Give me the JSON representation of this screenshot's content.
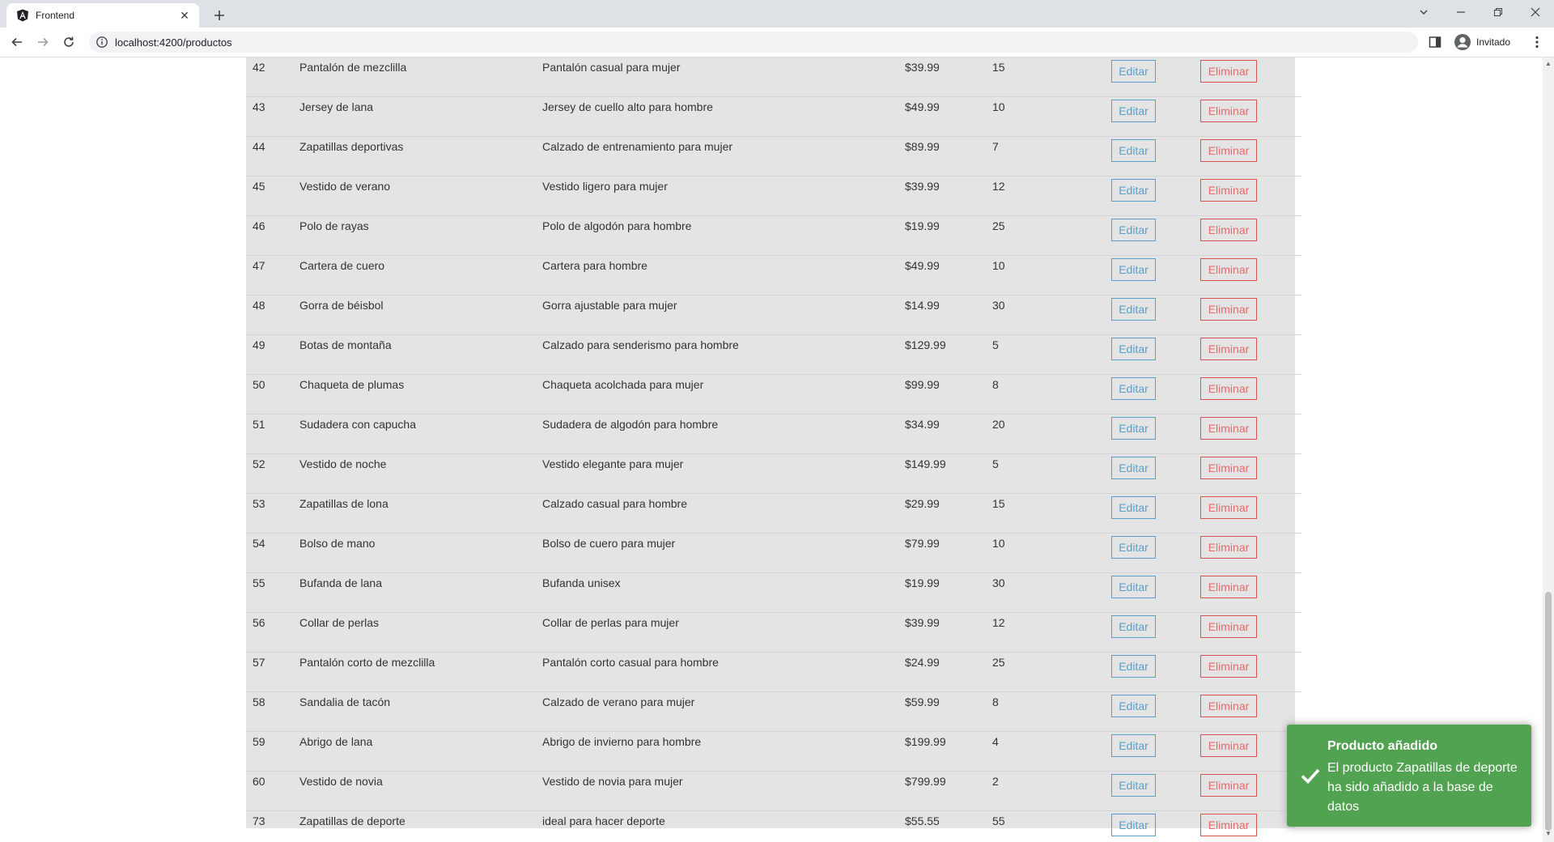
{
  "browser": {
    "tab_title": "Frontend",
    "url": "localhost:4200/productos",
    "profile_label": "Invitado"
  },
  "colors": {
    "edit_button": "#5a9fc8",
    "delete_button": "#d9534f",
    "toast_success": "#51a351",
    "table_background": "#e4e4e4"
  },
  "icons": {
    "tab_favicon": "angular-logo-icon",
    "toast": "checkmark-icon"
  },
  "products": [
    {
      "id": "42",
      "name": "Pantalón de mezclilla",
      "description": "Pantalón casual para mujer",
      "price": "$39.99",
      "stock": "15",
      "edit_label": "Editar",
      "delete_label": "Eliminar"
    },
    {
      "id": "43",
      "name": "Jersey de lana",
      "description": "Jersey de cuello alto para hombre",
      "price": "$49.99",
      "stock": "10",
      "edit_label": "Editar",
      "delete_label": "Eliminar"
    },
    {
      "id": "44",
      "name": "Zapatillas deportivas",
      "description": "Calzado de entrenamiento para mujer",
      "price": "$89.99",
      "stock": "7",
      "edit_label": "Editar",
      "delete_label": "Eliminar"
    },
    {
      "id": "45",
      "name": "Vestido de verano",
      "description": "Vestido ligero para mujer",
      "price": "$39.99",
      "stock": "12",
      "edit_label": "Editar",
      "delete_label": "Eliminar"
    },
    {
      "id": "46",
      "name": "Polo de rayas",
      "description": "Polo de algodón para hombre",
      "price": "$19.99",
      "stock": "25",
      "edit_label": "Editar",
      "delete_label": "Eliminar"
    },
    {
      "id": "47",
      "name": "Cartera de cuero",
      "description": "Cartera para hombre",
      "price": "$49.99",
      "stock": "10",
      "edit_label": "Editar",
      "delete_label": "Eliminar"
    },
    {
      "id": "48",
      "name": "Gorra de béisbol",
      "description": "Gorra ajustable para mujer",
      "price": "$14.99",
      "stock": "30",
      "edit_label": "Editar",
      "delete_label": "Eliminar"
    },
    {
      "id": "49",
      "name": "Botas de montaña",
      "description": "Calzado para senderismo para hombre",
      "price": "$129.99",
      "stock": "5",
      "edit_label": "Editar",
      "delete_label": "Eliminar"
    },
    {
      "id": "50",
      "name": "Chaqueta de plumas",
      "description": "Chaqueta acolchada para mujer",
      "price": "$99.99",
      "stock": "8",
      "edit_label": "Editar",
      "delete_label": "Eliminar"
    },
    {
      "id": "51",
      "name": "Sudadera con capucha",
      "description": "Sudadera de algodón para hombre",
      "price": "$34.99",
      "stock": "20",
      "edit_label": "Editar",
      "delete_label": "Eliminar"
    },
    {
      "id": "52",
      "name": "Vestido de noche",
      "description": "Vestido elegante para mujer",
      "price": "$149.99",
      "stock": "5",
      "edit_label": "Editar",
      "delete_label": "Eliminar"
    },
    {
      "id": "53",
      "name": "Zapatillas de lona",
      "description": "Calzado casual para hombre",
      "price": "$29.99",
      "stock": "15",
      "edit_label": "Editar",
      "delete_label": "Eliminar"
    },
    {
      "id": "54",
      "name": "Bolso de mano",
      "description": "Bolso de cuero para mujer",
      "price": "$79.99",
      "stock": "10",
      "edit_label": "Editar",
      "delete_label": "Eliminar"
    },
    {
      "id": "55",
      "name": "Bufanda de lana",
      "description": "Bufanda unisex",
      "price": "$19.99",
      "stock": "30",
      "edit_label": "Editar",
      "delete_label": "Eliminar"
    },
    {
      "id": "56",
      "name": "Collar de perlas",
      "description": "Collar de perlas para mujer",
      "price": "$39.99",
      "stock": "12",
      "edit_label": "Editar",
      "delete_label": "Eliminar"
    },
    {
      "id": "57",
      "name": "Pantalón corto de mezclilla",
      "description": "Pantalón corto casual para hombre",
      "price": "$24.99",
      "stock": "25",
      "edit_label": "Editar",
      "delete_label": "Eliminar"
    },
    {
      "id": "58",
      "name": "Sandalia de tacón",
      "description": "Calzado de verano para mujer",
      "price": "$59.99",
      "stock": "8",
      "edit_label": "Editar",
      "delete_label": "Eliminar"
    },
    {
      "id": "59",
      "name": "Abrigo de lana",
      "description": "Abrigo de invierno para hombre",
      "price": "$199.99",
      "stock": "4",
      "edit_label": "Editar",
      "delete_label": "Eliminar"
    },
    {
      "id": "60",
      "name": "Vestido de novia",
      "description": "Vestido de novia para mujer",
      "price": "$799.99",
      "stock": "2",
      "edit_label": "Editar",
      "delete_label": "Eliminar"
    },
    {
      "id": "73",
      "name": "Zapatillas de deporte",
      "description": "ideal para hacer deporte",
      "price": "$55.55",
      "stock": "55",
      "edit_label": "Editar",
      "delete_label": "Eliminar"
    }
  ],
  "toast": {
    "title": "Producto añadido",
    "message": "El producto Zapatillas de deporte ha sido añadido a la base de datos"
  }
}
